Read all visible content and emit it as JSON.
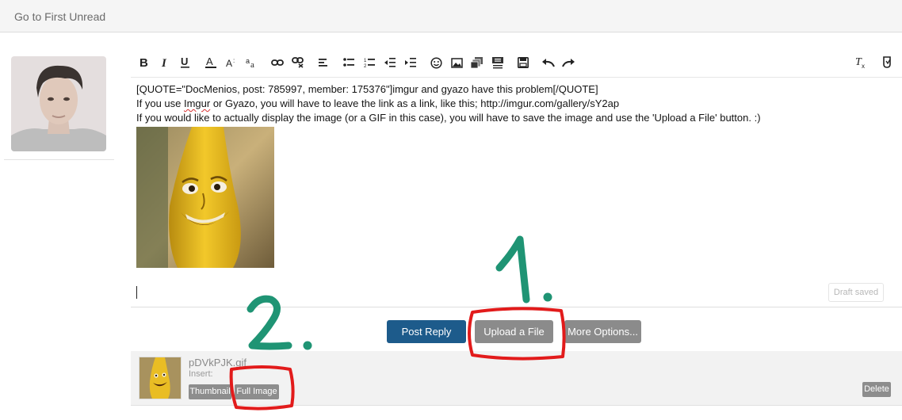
{
  "topbar": {
    "link_label": "Go to First Unread"
  },
  "toolbar": {
    "items": [
      "bold-icon",
      "italic-icon",
      "underline-icon",
      "text-color-icon",
      "font-size-icon",
      "font-family-icon",
      "link-icon",
      "unlink-icon",
      "align-icon",
      "bullet-list-icon",
      "numbered-list-icon",
      "outdent-icon",
      "indent-icon",
      "smiley-icon",
      "image-icon",
      "media-icon",
      "quote-icon",
      "save-draft-icon",
      "undo-icon",
      "redo-icon",
      "remove-format-icon",
      "bbcode-toggle-icon"
    ]
  },
  "editor": {
    "line1": "[QUOTE=\"DocMenios, post: 785997, member: 175376\"]imgur and gyazo have this problem[/QUOTE]",
    "line2_before": "If you use ",
    "line2_spell": "Imgur",
    "line2_after": " or Gyazo, you will have to leave the link as a link, like this; http://imgur.com/gallery/sY2ap",
    "line3": "If you would like to actually display the image (or a GIF in this case), you will have to save the image and use the 'Upload a File' button. :)",
    "draft_status": "Draft saved"
  },
  "buttons": {
    "post_reply": "Post Reply",
    "upload": "Upload a File",
    "more_options": "More Options..."
  },
  "attachment": {
    "filename": "pDVkPJK.gif",
    "insert_label": "Insert:",
    "thumbnail_label": "Thumbnail",
    "full_image_label": "Full Image",
    "delete_label": "Delete"
  },
  "annotations": {
    "step1": "1.",
    "step2": "2."
  },
  "colors": {
    "primary": "#1d5b8b",
    "secondary": "#8b8b8b",
    "marker_green": "#1f9474",
    "marker_red": "#e21b1b"
  }
}
